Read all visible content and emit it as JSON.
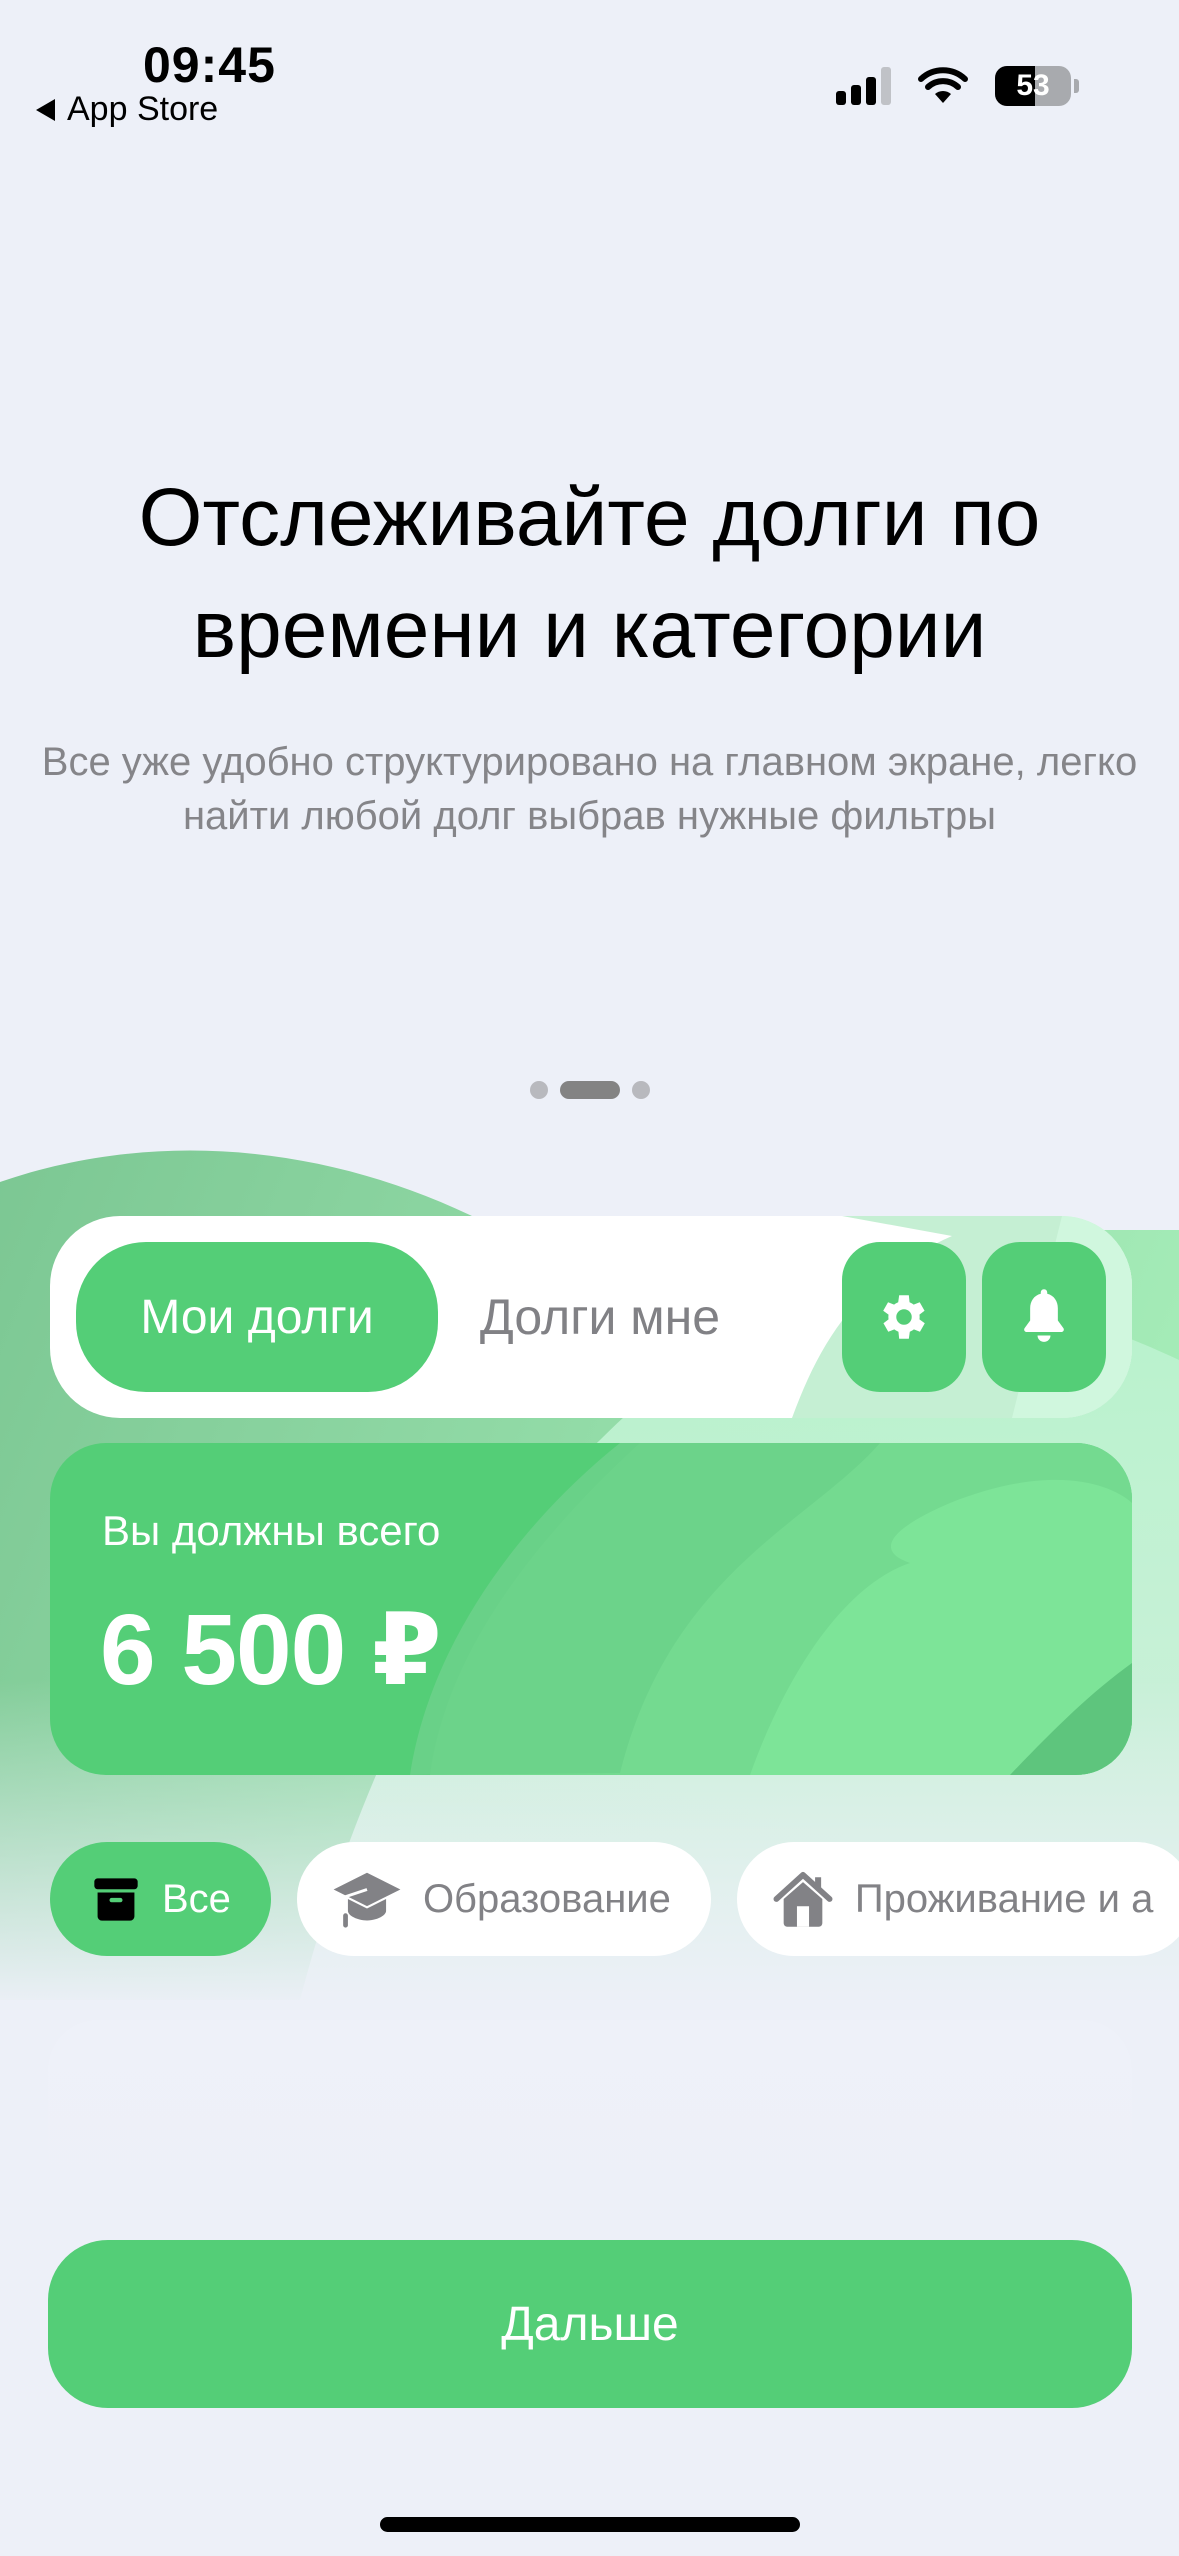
{
  "status_bar": {
    "time": "09:45",
    "back_app": "App Store",
    "battery_percent": "53",
    "battery_level": 0.53,
    "signal_bars_active": 3,
    "signal_bars_total": 4
  },
  "onboarding": {
    "title": "Отслеживайте долги по времени и категории",
    "subtitle": "Все уже удобно структурировано на главном экране, легко найти любой долг выбрав нужные фильтры",
    "page_indicator": {
      "current": 2,
      "total": 3
    }
  },
  "preview": {
    "tabs": [
      {
        "label": "Мои долги",
        "active": true
      },
      {
        "label": "Долги мне",
        "active": false
      }
    ],
    "icon_buttons": [
      {
        "icon": "gear-icon",
        "label": "Настройки"
      },
      {
        "icon": "bell-icon",
        "label": "Уведомления"
      }
    ],
    "balance": {
      "label": "Вы должны всего",
      "amount": "6 500 ₽"
    },
    "categories": [
      {
        "label": "Все",
        "icon": "archive-box-icon",
        "active": true
      },
      {
        "label": "Образование",
        "icon": "graduation-cap-icon",
        "active": false
      },
      {
        "label": "Проживание и а",
        "icon": "house-icon",
        "active": false
      }
    ]
  },
  "actions": {
    "next_label": "Дальше"
  },
  "colors": {
    "accent": "#54ce77",
    "background": "#edf0f8",
    "muted_text": "#858589",
    "title_text": "#000000"
  }
}
